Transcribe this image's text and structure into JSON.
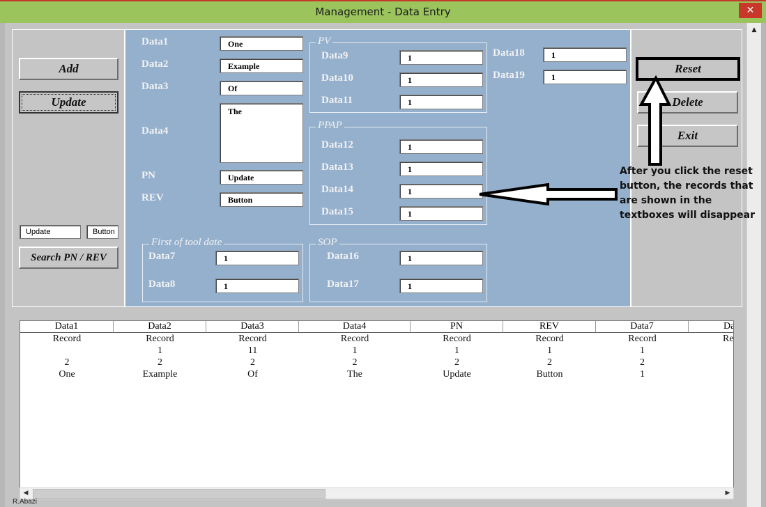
{
  "window": {
    "title": "Management - Data Entry",
    "close_glyph": "✕"
  },
  "left": {
    "add": "Add",
    "update": "Update",
    "search_pn_value": "Update",
    "search_rev_value": "Button",
    "search": "Search PN / REV"
  },
  "form": {
    "data1": {
      "label": "Data1",
      "value": "One"
    },
    "data2": {
      "label": "Data2",
      "value": "Example"
    },
    "data3": {
      "label": "Data3",
      "value": "Of"
    },
    "data4": {
      "label": "Data4",
      "value": "The"
    },
    "pn": {
      "label": "PN",
      "value": "Update"
    },
    "rev": {
      "label": "REV",
      "value": "Button"
    }
  },
  "pv": {
    "title": "PV",
    "data9": {
      "label": "Data9",
      "value": "1"
    },
    "data10": {
      "label": "Data10",
      "value": "1"
    },
    "data11": {
      "label": "Data11",
      "value": "1"
    }
  },
  "ppap": {
    "title": "PPAP",
    "data12": {
      "label": "Data12",
      "value": "1"
    },
    "data13": {
      "label": "Data13",
      "value": "1"
    },
    "data14": {
      "label": "Data14",
      "value": "1"
    },
    "data15": {
      "label": "Data15",
      "value": "1"
    }
  },
  "first_tool": {
    "title": "First of tool date",
    "data7": {
      "label": "Data7",
      "value": "1"
    },
    "data8": {
      "label": "Data8",
      "value": "1"
    }
  },
  "sop": {
    "title": "SOP",
    "data16": {
      "label": "Data16",
      "value": "1"
    },
    "data17": {
      "label": "Data17",
      "value": "1"
    }
  },
  "extra": {
    "data18": {
      "label": "Data18",
      "value": "1"
    },
    "data19": {
      "label": "Data19",
      "value": "1"
    }
  },
  "right": {
    "reset": "Reset",
    "delete": "Delete",
    "exit": "Exit"
  },
  "annotation": "After you click the reset button, the records that are shown in the textboxes will disappear",
  "table": {
    "columns": [
      "Data1",
      "Data2",
      "Data3",
      "Data4",
      "PN",
      "REV",
      "Data7",
      "Da"
    ],
    "rows": [
      [
        "Record",
        "Record",
        "Record",
        "Record",
        "Record",
        "Record",
        "Record",
        "Re"
      ],
      [
        "",
        "1",
        "11",
        "1",
        "1",
        "1",
        "1",
        ""
      ],
      [
        "2",
        "2",
        "2",
        "2",
        "2",
        "2",
        "2",
        ""
      ],
      [
        "One",
        "Example",
        "Of",
        "The",
        "Update",
        "Button",
        "1",
        ""
      ]
    ]
  },
  "scroll": {
    "up": "▲",
    "left": "◀",
    "right": "▶"
  },
  "footer": "R.Abazi"
}
